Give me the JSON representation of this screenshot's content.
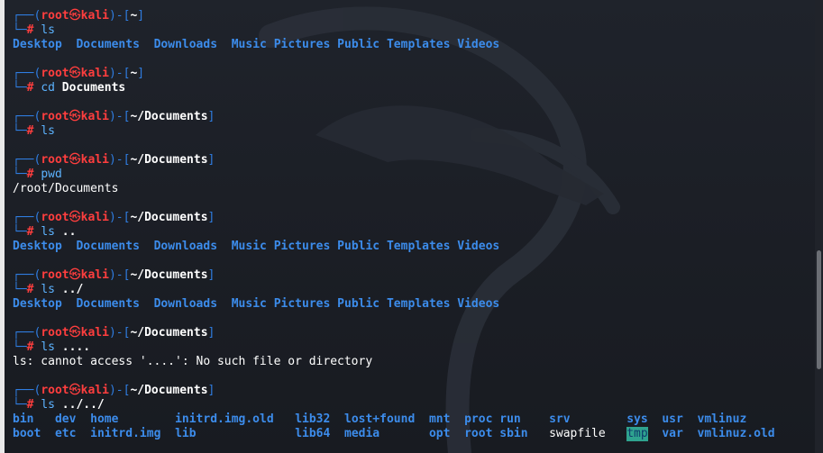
{
  "prompt": {
    "open": "┌──(",
    "user": "root",
    "at": "㉿",
    "host": "kali",
    "mid": ")-[",
    "close": "]",
    "corner": "└─",
    "hash": "# "
  },
  "home_listing": [
    "Desktop",
    "Documents",
    "Downloads",
    "Music",
    "Pictures",
    "Public",
    "Templates",
    "Videos"
  ],
  "blocks": [
    {
      "path": "~",
      "cmd": "ls",
      "arg": "",
      "output_type": "listing"
    },
    {
      "path": "~",
      "cmd": "cd",
      "arg": "Documents",
      "output_type": "none"
    },
    {
      "path": "~/Documents",
      "cmd": "ls",
      "arg": "",
      "output_type": "none"
    },
    {
      "path": "~/Documents",
      "cmd": "pwd",
      "arg": "",
      "output_type": "text",
      "output": "/root/Documents"
    },
    {
      "path": "~/Documents",
      "cmd": "ls",
      "arg": "..",
      "output_type": "listing"
    },
    {
      "path": "~/Documents",
      "cmd": "ls",
      "arg": "../",
      "output_type": "listing"
    },
    {
      "path": "~/Documents",
      "cmd": "ls",
      "arg": "....",
      "output_type": "text",
      "output": "ls: cannot access '....': No such file or directory"
    },
    {
      "path": "~/Documents",
      "cmd": "ls",
      "arg": "../../",
      "output_type": "root"
    }
  ],
  "root_listing": {
    "row1": [
      {
        "name": "bin",
        "style": "dir"
      },
      {
        "name": "dev",
        "style": "dir"
      },
      {
        "name": "home",
        "style": "dir"
      },
      {
        "name": "initrd.img.old",
        "style": "dir"
      },
      {
        "name": "lib32",
        "style": "dir"
      },
      {
        "name": "lost+found",
        "style": "dir"
      },
      {
        "name": "mnt",
        "style": "dir"
      },
      {
        "name": "proc",
        "style": "dir"
      },
      {
        "name": "run",
        "style": "dir"
      },
      {
        "name": "srv",
        "style": "dir"
      },
      {
        "name": "sys",
        "style": "dir"
      },
      {
        "name": "usr",
        "style": "dir"
      },
      {
        "name": "vmlinuz",
        "style": "dir"
      }
    ],
    "row2": [
      {
        "name": "boot",
        "style": "dir"
      },
      {
        "name": "etc",
        "style": "dir"
      },
      {
        "name": "initrd.img",
        "style": "dir"
      },
      {
        "name": "lib",
        "style": "dir"
      },
      {
        "name": "lib64",
        "style": "dir"
      },
      {
        "name": "media",
        "style": "dir"
      },
      {
        "name": "opt",
        "style": "dir"
      },
      {
        "name": "root",
        "style": "dir"
      },
      {
        "name": "sbin",
        "style": "dir"
      },
      {
        "name": "swapfile",
        "style": "plain"
      },
      {
        "name": "tmp",
        "style": "hl"
      },
      {
        "name": "var",
        "style": "dir"
      },
      {
        "name": "vmlinuz.old",
        "style": "dir"
      }
    ]
  },
  "colors": {
    "background": "#1b1e25",
    "prompt_frame": "#2f7de1",
    "prompt_user": "#ff3e3e",
    "directory": "#3c8ceb",
    "command": "#5cb3ff",
    "sticky_dir_bg": "#2fa38f"
  }
}
